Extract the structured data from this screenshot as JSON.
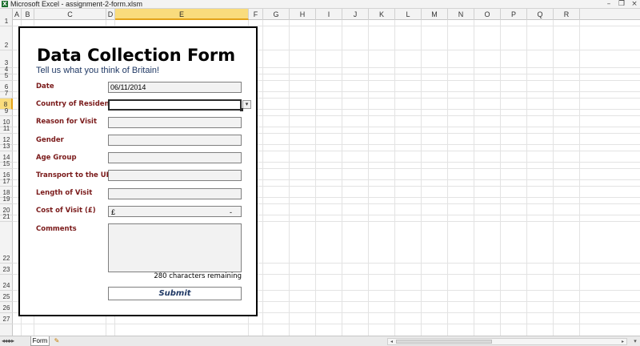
{
  "window": {
    "title": "Microsoft Excel - assignment-2-form.xlsm",
    "app_icon": "excel-icon",
    "icon_glyph": "X"
  },
  "grid": {
    "columns": [
      "A",
      "B",
      "C",
      "D",
      "E",
      "F",
      "G",
      "H",
      "I",
      "J",
      "K",
      "L",
      "M",
      "N",
      "O",
      "P",
      "Q",
      "R"
    ],
    "rows": [
      "1",
      "2",
      "3",
      "4",
      "5",
      "6",
      "7",
      "8",
      "9",
      "10",
      "11",
      "12",
      "13",
      "14",
      "15",
      "16",
      "17",
      "18",
      "19",
      "20",
      "21",
      "22",
      "23",
      "24",
      "25",
      "26",
      "27"
    ],
    "selected_column": "E",
    "selected_row": "8"
  },
  "form": {
    "title": "Data Collection Form",
    "subtitle": "Tell us what you think of Britain!",
    "fields": [
      {
        "label": "Date",
        "value": "06/11/2014"
      },
      {
        "label": "Country of Residence",
        "value": ""
      },
      {
        "label": "Reason for Visit",
        "value": ""
      },
      {
        "label": "Gender",
        "value": ""
      },
      {
        "label": "Age Group",
        "value": ""
      },
      {
        "label": "Transport to the UK",
        "value": ""
      },
      {
        "label": "Length of Visit",
        "value": ""
      },
      {
        "label": "Cost of Visit (£)",
        "value": ""
      }
    ],
    "currency_symbol": "£",
    "currency_dash": "-",
    "comments_label": "Comments",
    "remaining_text": "280 characters remaining",
    "submit_label": "Submit",
    "dropdown_glyph": "▾"
  },
  "sheets": {
    "tabs": [
      "Form"
    ],
    "active": "Form"
  },
  "colors": {
    "label": "#7a1a1a",
    "subtitle": "#1f3864",
    "selection_header": "#f9dc7d"
  }
}
